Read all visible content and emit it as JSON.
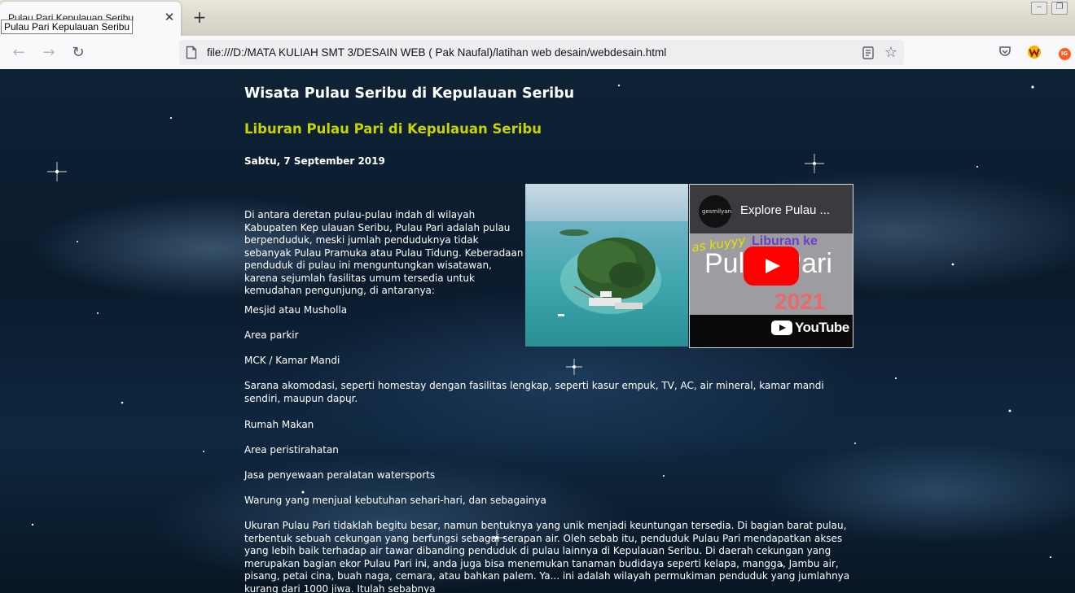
{
  "browser": {
    "tab": {
      "title": "Pulau Pari Kepulauan Seribu",
      "tooltip": "Pulau Pari Kepulauan Seribu",
      "close_glyph": "✕"
    },
    "new_tab_glyph": "+",
    "window_controls": {
      "minimize": "‒",
      "restore": "❐"
    },
    "nav": {
      "back": "←",
      "forward": "→",
      "reload": "↻"
    },
    "url": "file:///D:/MATA KULIAH SMT 3/DESAIN WEB ( Pak Naufal)/latihan web desain/webdesain.html",
    "url_icons": {
      "reader": "reader-view-icon",
      "bookmark": "☆"
    },
    "toolbar_icons": [
      "pocket-icon",
      "extension-w-icon",
      "extension-ig-icon"
    ],
    "extension_ig_label": "IG"
  },
  "page": {
    "site_title": "Wisata Pulau Seribu di Kepulauan Seribu",
    "article_title": "Liburan Pulau Pari di Kepulauan Seribu",
    "date": "Sabtu, 7 September 2019",
    "intro": "Di antara deretan pulau-pulau indah di wilayah Kabupaten Kep ulauan Seribu, Pulau Pari adalah pulau berpenduduk, meski jumlah penduduknya tidak sebanyak Pulau Pramuka atau Pulau Tidung. Keberadaan penduduk di pulau ini menguntungkan wisatawan, karena sejumlah fasilitas umum tersedia untuk kemudahan pengunjung, di antaranya:",
    "facilities": [
      "Mesjid atau Musholla",
      "Area parkir",
      "MCK / Kamar Mandi",
      "Sarana akomodasi, seperti homestay dengan fasilitas lengkap, seperti kasur empuk, TV, AC, air mineral, kamar mandi sendiri, maupun dapur.",
      "Rumah Makan",
      "Area peristirahatan",
      "Jasa penyewaan peralatan watersports",
      "Warung yang menjual kebutuhan sehari-hari, dan sebagainya"
    ],
    "closing_paragraph": "Ukuran Pulau Pari tidaklah begitu besar, namun bentuknya yang unik menjadi keuntungan tersedia. Di bagian barat pulau, terbentuk sebuah cekungan yang berfungsi sebagai serapan air. Oleh sebab itu, penduduk Pulau Pari mendapatkan akses yang lebih baik terhadap air tawar dibanding penduduk di pulau lainnya di Kepulauan Seribu. Di daerah cekungan yang merupakan bagian ekor Pulau Pari ini, anda juga bisa menemukan tanaman budidaya seperti kelapa, mangga, Jambu air, pisang, petai cina, buah naga, cemara, atau bahkan palem. Ya... ini adalah wilayah permukiman penduduk yang jumlahnya kurang dari 1000 jiwa. Itulah sebabnya",
    "video": {
      "title": "Explore Pulau ...",
      "channel": "gesmilyan",
      "overlay_line1": "Liburan ke",
      "overlay_line2": "Pulau Pari",
      "overlay_year": "2021",
      "overlay_script": "as kuyyy",
      "platform": "YouTube"
    }
  },
  "colors": {
    "article_title": "#c8d400",
    "body_text": "#ffffff",
    "youtube_red": "#ff0000"
  }
}
